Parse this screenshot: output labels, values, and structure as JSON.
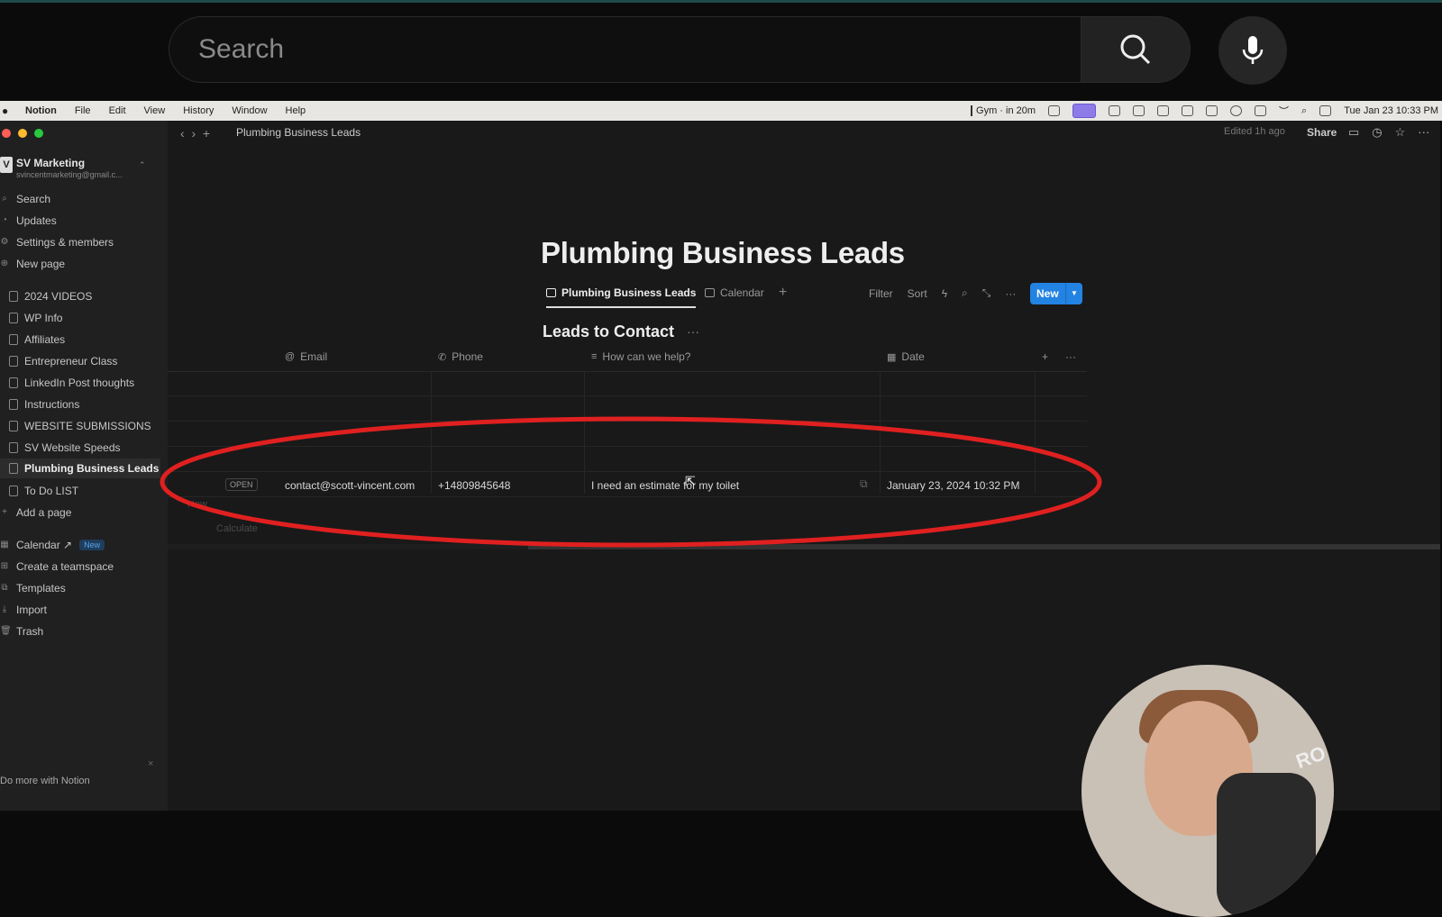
{
  "youtube": {
    "search_placeholder": "Search"
  },
  "menubar": {
    "app": "Notion",
    "items": [
      "File",
      "Edit",
      "View",
      "History",
      "Window",
      "Help"
    ],
    "status": "Gym · in 20m",
    "datetime": "Tue Jan 23  10:33 PM"
  },
  "sidebar": {
    "workspace_name": "SV Marketing",
    "workspace_email": "svincentmarketing@gmail.c...",
    "top_items": [
      "Search",
      "Updates",
      "Settings & members",
      "New page"
    ],
    "pages": [
      "2024 VIDEOS",
      "WP Info",
      "Affiliates",
      "Entrepreneur Class",
      "LinkedIn Post thoughts",
      "Instructions",
      "WEBSITE SUBMISSIONS",
      "SV Website Speeds",
      "Plumbing Business Leads",
      "To Do LIST"
    ],
    "add_page": "Add a page",
    "calendar": "Calendar ↗",
    "calendar_badge": "New",
    "bottom_items": [
      "Create a teamspace",
      "Templates",
      "Import",
      "Trash"
    ],
    "footer": "Do more with Notion"
  },
  "topbar": {
    "breadcrumb": "Plumbing Business Leads",
    "edited": "Edited 1h ago",
    "share": "Share"
  },
  "page": {
    "title": "Plumbing Business Leads",
    "views": [
      "Plumbing Business Leads",
      "Calendar"
    ],
    "tools": [
      "Filter",
      "Sort"
    ],
    "new_button": "New",
    "db_title": "Leads to Contact",
    "columns": [
      "Email",
      "Phone",
      "How can we help?",
      "Date"
    ],
    "row": {
      "status": "OPEN",
      "email": "contact@scott-vincent.com",
      "phone": "+14809845648",
      "help": "I need an estimate for my toilet",
      "date": "January 23, 2024 10:32 PM"
    },
    "add_new": "New",
    "calculate": "Calculate"
  },
  "webcam": {
    "mic_text": "RO"
  },
  "colors": {
    "accent": "#2383e2",
    "highlight_oval": "#e02020",
    "background": "#191919",
    "sidebar": "#202020"
  }
}
